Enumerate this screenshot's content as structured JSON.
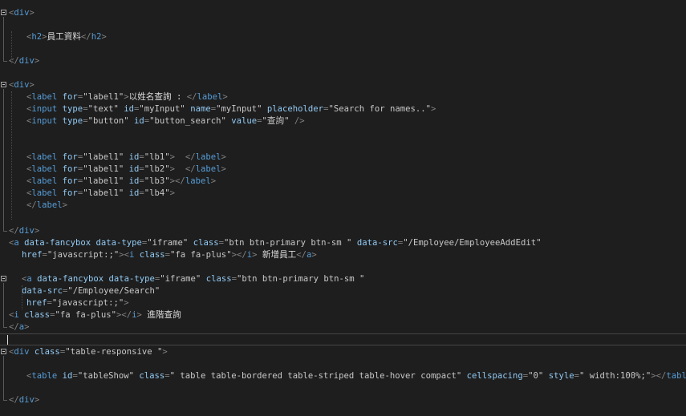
{
  "editor": {
    "colors": {
      "background": "#1e1e1e",
      "delimiter": "#808080",
      "tag": "#569cd6",
      "attribute": "#92caf4",
      "value": "#c8c8c8",
      "text": "#dcdcdc"
    },
    "lines": [
      {
        "fold": true,
        "tokens": [
          {
            "k": "del",
            "t": "<"
          },
          {
            "k": "tag",
            "t": "div"
          },
          {
            "k": "del",
            "t": ">"
          }
        ]
      },
      {
        "tokens": []
      },
      {
        "tokens": [
          {
            "k": "del",
            "t": "<"
          },
          {
            "k": "tag",
            "t": "h2"
          },
          {
            "k": "del",
            "t": ">"
          },
          {
            "k": "text",
            "t": "員工資料"
          },
          {
            "k": "del",
            "t": "</"
          },
          {
            "k": "tag",
            "t": "h2"
          },
          {
            "k": "del",
            "t": ">"
          }
        ]
      },
      {
        "tokens": []
      },
      {
        "tokens": [
          {
            "k": "del",
            "t": "</"
          },
          {
            "k": "tag",
            "t": "div"
          },
          {
            "k": "del",
            "t": ">"
          }
        ]
      },
      {
        "tokens": []
      },
      {
        "fold": true,
        "tokens": [
          {
            "k": "del",
            "t": "<"
          },
          {
            "k": "tag",
            "t": "div"
          },
          {
            "k": "del",
            "t": ">"
          }
        ]
      },
      {
        "tokens": [
          {
            "k": "del",
            "t": "<"
          },
          {
            "k": "tag",
            "t": "label"
          },
          {
            "k": "text",
            "t": " "
          },
          {
            "k": "attr",
            "t": "for"
          },
          {
            "k": "del",
            "t": "="
          },
          {
            "k": "val",
            "t": "\"label1\""
          },
          {
            "k": "del",
            "t": ">"
          },
          {
            "k": "text",
            "t": "以姓名查詢 : "
          },
          {
            "k": "del",
            "t": "</"
          },
          {
            "k": "tag",
            "t": "label"
          },
          {
            "k": "del",
            "t": ">"
          }
        ]
      },
      {
        "tokens": [
          {
            "k": "del",
            "t": "<"
          },
          {
            "k": "tag",
            "t": "input"
          },
          {
            "k": "text",
            "t": " "
          },
          {
            "k": "attr",
            "t": "type"
          },
          {
            "k": "del",
            "t": "="
          },
          {
            "k": "val",
            "t": "\"text\""
          },
          {
            "k": "text",
            "t": " "
          },
          {
            "k": "attr",
            "t": "id"
          },
          {
            "k": "del",
            "t": "="
          },
          {
            "k": "val",
            "t": "\"myInput\""
          },
          {
            "k": "text",
            "t": " "
          },
          {
            "k": "attr",
            "t": "name"
          },
          {
            "k": "del",
            "t": "="
          },
          {
            "k": "val",
            "t": "\"myInput\""
          },
          {
            "k": "text",
            "t": " "
          },
          {
            "k": "attr",
            "t": "placeholder"
          },
          {
            "k": "del",
            "t": "="
          },
          {
            "k": "val",
            "t": "\"Search for names..\""
          },
          {
            "k": "del",
            "t": ">"
          }
        ]
      },
      {
        "tokens": [
          {
            "k": "del",
            "t": "<"
          },
          {
            "k": "tag",
            "t": "input"
          },
          {
            "k": "text",
            "t": " "
          },
          {
            "k": "attr",
            "t": "type"
          },
          {
            "k": "del",
            "t": "="
          },
          {
            "k": "val",
            "t": "\"button\""
          },
          {
            "k": "text",
            "t": " "
          },
          {
            "k": "attr",
            "t": "id"
          },
          {
            "k": "del",
            "t": "="
          },
          {
            "k": "val",
            "t": "\"button_search\""
          },
          {
            "k": "text",
            "t": " "
          },
          {
            "k": "attr",
            "t": "value"
          },
          {
            "k": "del",
            "t": "="
          },
          {
            "k": "val",
            "t": "\"查詢\""
          },
          {
            "k": "text",
            "t": " "
          },
          {
            "k": "del",
            "t": "/>"
          }
        ]
      },
      {
        "tokens": []
      },
      {
        "tokens": []
      },
      {
        "tokens": [
          {
            "k": "del",
            "t": "<"
          },
          {
            "k": "tag",
            "t": "label"
          },
          {
            "k": "text",
            "t": " "
          },
          {
            "k": "attr",
            "t": "for"
          },
          {
            "k": "del",
            "t": "="
          },
          {
            "k": "val",
            "t": "\"label1\""
          },
          {
            "k": "text",
            "t": " "
          },
          {
            "k": "attr",
            "t": "id"
          },
          {
            "k": "del",
            "t": "="
          },
          {
            "k": "val",
            "t": "\"lb1\""
          },
          {
            "k": "del",
            "t": ">"
          },
          {
            "k": "text",
            "t": "  "
          },
          {
            "k": "del",
            "t": "</"
          },
          {
            "k": "tag",
            "t": "label"
          },
          {
            "k": "del",
            "t": ">"
          }
        ]
      },
      {
        "tokens": [
          {
            "k": "del",
            "t": "<"
          },
          {
            "k": "tag",
            "t": "label"
          },
          {
            "k": "text",
            "t": " "
          },
          {
            "k": "attr",
            "t": "for"
          },
          {
            "k": "del",
            "t": "="
          },
          {
            "k": "val",
            "t": "\"label1\""
          },
          {
            "k": "text",
            "t": " "
          },
          {
            "k": "attr",
            "t": "id"
          },
          {
            "k": "del",
            "t": "="
          },
          {
            "k": "val",
            "t": "\"lb2\""
          },
          {
            "k": "del",
            "t": ">"
          },
          {
            "k": "text",
            "t": "  "
          },
          {
            "k": "del",
            "t": "</"
          },
          {
            "k": "tag",
            "t": "label"
          },
          {
            "k": "del",
            "t": ">"
          }
        ]
      },
      {
        "tokens": [
          {
            "k": "del",
            "t": "<"
          },
          {
            "k": "tag",
            "t": "label"
          },
          {
            "k": "text",
            "t": " "
          },
          {
            "k": "attr",
            "t": "for"
          },
          {
            "k": "del",
            "t": "="
          },
          {
            "k": "val",
            "t": "\"label1\""
          },
          {
            "k": "text",
            "t": " "
          },
          {
            "k": "attr",
            "t": "id"
          },
          {
            "k": "del",
            "t": "="
          },
          {
            "k": "val",
            "t": "\"lb3\""
          },
          {
            "k": "del",
            "t": "></"
          },
          {
            "k": "tag",
            "t": "label"
          },
          {
            "k": "del",
            "t": ">"
          }
        ]
      },
      {
        "tokens": [
          {
            "k": "del",
            "t": "<"
          },
          {
            "k": "tag",
            "t": "label"
          },
          {
            "k": "text",
            "t": " "
          },
          {
            "k": "attr",
            "t": "for"
          },
          {
            "k": "del",
            "t": "="
          },
          {
            "k": "val",
            "t": "\"label1\""
          },
          {
            "k": "text",
            "t": " "
          },
          {
            "k": "attr",
            "t": "id"
          },
          {
            "k": "del",
            "t": "="
          },
          {
            "k": "val",
            "t": "\"lb4\""
          },
          {
            "k": "del",
            "t": ">"
          }
        ]
      },
      {
        "tokens": [
          {
            "k": "del",
            "t": "</"
          },
          {
            "k": "tag",
            "t": "label"
          },
          {
            "k": "del",
            "t": ">"
          }
        ]
      },
      {
        "tokens": []
      },
      {
        "tokens": [
          {
            "k": "del",
            "t": "</"
          },
          {
            "k": "tag",
            "t": "div"
          },
          {
            "k": "del",
            "t": ">"
          }
        ]
      },
      {
        "tokens": [
          {
            "k": "del",
            "t": "<"
          },
          {
            "k": "tag",
            "t": "a"
          },
          {
            "k": "text",
            "t": " "
          },
          {
            "k": "attr",
            "t": "data-fancybox"
          },
          {
            "k": "text",
            "t": " "
          },
          {
            "k": "attr",
            "t": "data-type"
          },
          {
            "k": "del",
            "t": "="
          },
          {
            "k": "val",
            "t": "\"iframe\""
          },
          {
            "k": "text",
            "t": " "
          },
          {
            "k": "attr",
            "t": "class"
          },
          {
            "k": "del",
            "t": "="
          },
          {
            "k": "val",
            "t": "\"btn btn-primary btn-sm \""
          },
          {
            "k": "text",
            "t": " "
          },
          {
            "k": "attr",
            "t": "data-src"
          },
          {
            "k": "del",
            "t": "="
          },
          {
            "k": "val",
            "t": "\"/Employee/EmployeeAddEdit\""
          }
        ]
      },
      {
        "tokens": [
          {
            "k": "attr",
            "t": "href"
          },
          {
            "k": "del",
            "t": "="
          },
          {
            "k": "val",
            "t": "\"javascript:;\""
          },
          {
            "k": "del",
            "t": "><"
          },
          {
            "k": "tag",
            "t": "i"
          },
          {
            "k": "text",
            "t": " "
          },
          {
            "k": "attr",
            "t": "class"
          },
          {
            "k": "del",
            "t": "="
          },
          {
            "k": "val",
            "t": "\"fa fa-plus\""
          },
          {
            "k": "del",
            "t": "></"
          },
          {
            "k": "tag",
            "t": "i"
          },
          {
            "k": "del",
            "t": ">"
          },
          {
            "k": "text",
            "t": " 新增員工"
          },
          {
            "k": "del",
            "t": "</"
          },
          {
            "k": "tag",
            "t": "a"
          },
          {
            "k": "del",
            "t": ">"
          }
        ]
      },
      {
        "tokens": []
      },
      {
        "fold": true,
        "tokens": [
          {
            "k": "del",
            "t": "<"
          },
          {
            "k": "tag",
            "t": "a"
          },
          {
            "k": "text",
            "t": " "
          },
          {
            "k": "attr",
            "t": "data-fancybox"
          },
          {
            "k": "text",
            "t": " "
          },
          {
            "k": "attr",
            "t": "data-type"
          },
          {
            "k": "del",
            "t": "="
          },
          {
            "k": "val",
            "t": "\"iframe\""
          },
          {
            "k": "text",
            "t": " "
          },
          {
            "k": "attr",
            "t": "class"
          },
          {
            "k": "del",
            "t": "="
          },
          {
            "k": "val",
            "t": "\"btn btn-primary btn-sm \""
          }
        ]
      },
      {
        "tokens": [
          {
            "k": "attr",
            "t": "data-src"
          },
          {
            "k": "del",
            "t": "="
          },
          {
            "k": "val",
            "t": "\"/Employee/Search\""
          }
        ]
      },
      {
        "tokens": [
          {
            "k": "attr",
            "t": "href"
          },
          {
            "k": "del",
            "t": "="
          },
          {
            "k": "val",
            "t": "\"javascript:;\""
          },
          {
            "k": "del",
            "t": ">"
          }
        ]
      },
      {
        "tokens": [
          {
            "k": "del",
            "t": "<"
          },
          {
            "k": "tag",
            "t": "i"
          },
          {
            "k": "text",
            "t": " "
          },
          {
            "k": "attr",
            "t": "class"
          },
          {
            "k": "del",
            "t": "="
          },
          {
            "k": "val",
            "t": "\"fa fa-plus\""
          },
          {
            "k": "del",
            "t": "></"
          },
          {
            "k": "tag",
            "t": "i"
          },
          {
            "k": "del",
            "t": ">"
          },
          {
            "k": "text",
            "t": " 進階查詢"
          }
        ]
      },
      {
        "tokens": [
          {
            "k": "del",
            "t": "</"
          },
          {
            "k": "tag",
            "t": "a"
          },
          {
            "k": "del",
            "t": ">"
          }
        ]
      },
      {
        "tokens": []
      },
      {
        "fold": true,
        "tokens": [
          {
            "k": "del",
            "t": "<"
          },
          {
            "k": "tag",
            "t": "div"
          },
          {
            "k": "text",
            "t": " "
          },
          {
            "k": "attr",
            "t": "class"
          },
          {
            "k": "del",
            "t": "="
          },
          {
            "k": "val",
            "t": "\"table-responsive \""
          },
          {
            "k": "del",
            "t": ">"
          }
        ]
      },
      {
        "tokens": []
      },
      {
        "tokens": [
          {
            "k": "del",
            "t": "<"
          },
          {
            "k": "tag",
            "t": "table"
          },
          {
            "k": "text",
            "t": " "
          },
          {
            "k": "attr",
            "t": "id"
          },
          {
            "k": "del",
            "t": "="
          },
          {
            "k": "val",
            "t": "\"tableShow\""
          },
          {
            "k": "text",
            "t": " "
          },
          {
            "k": "attr",
            "t": "class"
          },
          {
            "k": "del",
            "t": "="
          },
          {
            "k": "val",
            "t": "\" table table-bordered table-striped table-hover compact\""
          },
          {
            "k": "text",
            "t": " "
          },
          {
            "k": "attr",
            "t": "cellspacing"
          },
          {
            "k": "del",
            "t": "="
          },
          {
            "k": "val",
            "t": "\"0\""
          },
          {
            "k": "text",
            "t": " "
          },
          {
            "k": "attr",
            "t": "style"
          },
          {
            "k": "del",
            "t": "="
          },
          {
            "k": "val",
            "t": "\" width:100%;\""
          },
          {
            "k": "del",
            "t": "></"
          },
          {
            "k": "tag",
            "t": "table"
          },
          {
            "k": "del",
            "t": ">"
          }
        ]
      },
      {
        "tokens": []
      },
      {
        "tokens": [
          {
            "k": "del",
            "t": "</"
          },
          {
            "k": "tag",
            "t": "div"
          },
          {
            "k": "del",
            "t": ">"
          }
        ]
      }
    ]
  }
}
